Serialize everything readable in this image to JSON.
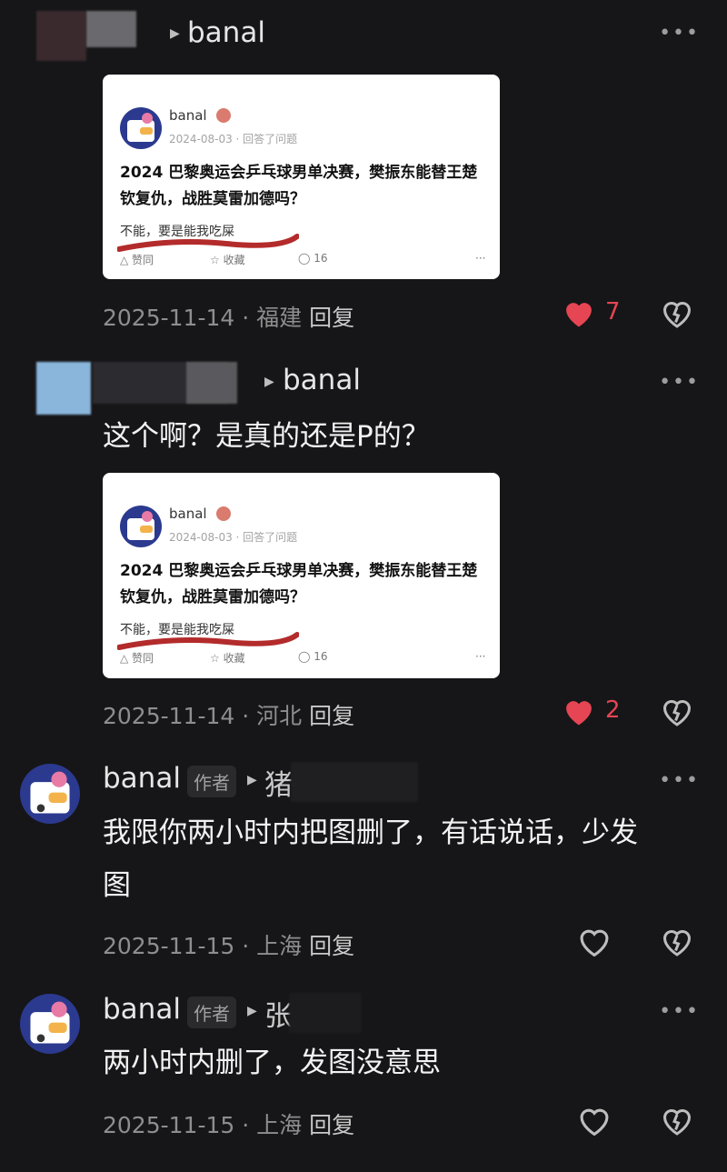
{
  "comments": [
    {
      "reply_to": "banal",
      "card": {
        "user": "banal",
        "meta": "2024-08-03 · 回答了问题",
        "title": "2024 巴黎奥运会乒乓球男单决赛，樊振东能替王楚钦复仇，战胜莫雷加德吗？",
        "answer": "不能，要是能我吃屎",
        "upvote": "赞同",
        "favorite": "收藏",
        "comment_count": "16"
      },
      "date": "2025-11-14",
      "location": "福建",
      "reply": "回复",
      "likes": "7"
    },
    {
      "reply_to": "banal",
      "text": "这个啊？是真的还是P的？",
      "card": {
        "user": "banal",
        "meta": "2024-08-03 · 回答了问题",
        "title": "2024 巴黎奥运会乒乓球男单决赛，樊振东能替王楚钦复仇，战胜莫雷加德吗？",
        "answer": "不能，要是能我吃屎",
        "upvote": "赞同",
        "favorite": "收藏",
        "comment_count": "16"
      },
      "date": "2025-11-14",
      "location": "河北",
      "reply": "回复",
      "likes": "2"
    },
    {
      "user": "banal",
      "tag": "作者",
      "reply_to_partial": "猪",
      "text_line1": "我限你两小时内把图删了，有话说话，少发",
      "text_line2": "图",
      "date": "2025-11-15",
      "location": "上海",
      "reply": "回复"
    },
    {
      "user": "banal",
      "tag": "作者",
      "reply_to_partial": "张",
      "text": "两小时内删了，发图没意思",
      "date": "2025-11-15",
      "location": "上海",
      "reply": "回复"
    }
  ],
  "icons": {
    "more": "more-icon",
    "like": "heart-icon",
    "dislike": "broken-heart-icon"
  },
  "colors": {
    "background": "#161618",
    "like_active": "#e64553",
    "underline": "#b32b2b"
  }
}
